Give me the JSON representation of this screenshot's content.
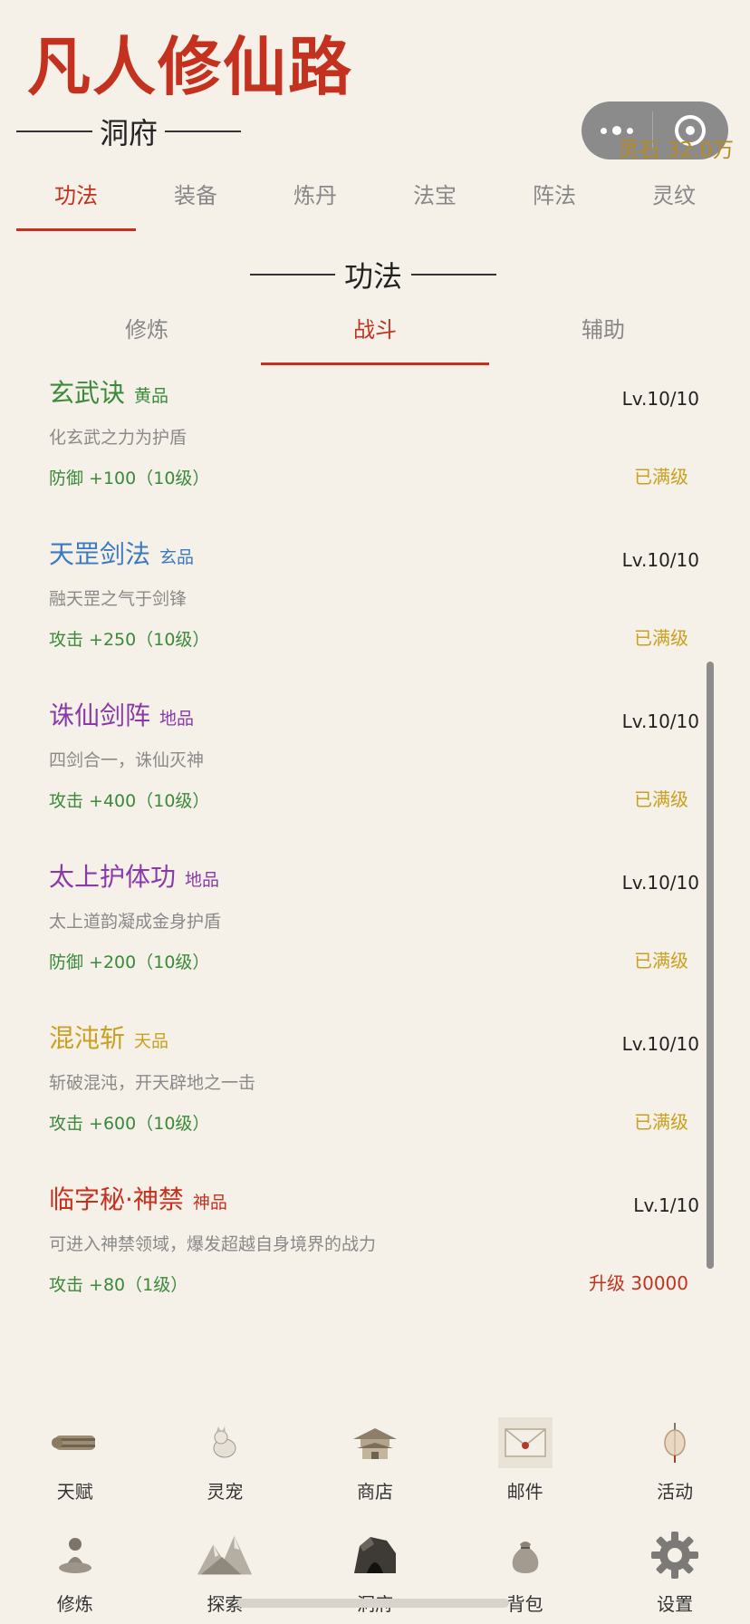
{
  "app": {
    "title": "凡人修仙路"
  },
  "header": {
    "spirit_stone": "灵石 32.0万",
    "section": "洞府"
  },
  "main_tabs": [
    {
      "label": "功法",
      "active": true
    },
    {
      "label": "装备",
      "active": false
    },
    {
      "label": "炼丹",
      "active": false
    },
    {
      "label": "法宝",
      "active": false
    },
    {
      "label": "阵法",
      "active": false
    },
    {
      "label": "灵纹",
      "active": false
    }
  ],
  "sub_section": "功法",
  "sub_tabs": [
    {
      "label": "修炼",
      "active": false
    },
    {
      "label": "战斗",
      "active": true
    },
    {
      "label": "辅助",
      "active": false
    }
  ],
  "skills": [
    {
      "name": "玄武诀",
      "grade": "黄品",
      "color": "#3a8a3a",
      "level": "Lv.10/10",
      "desc": "化玄武之力为护盾",
      "effect": "防御 +100（10级）",
      "status": "已满级"
    },
    {
      "name": "天罡剑法",
      "grade": "玄品",
      "color": "#3a7ac0",
      "level": "Lv.10/10",
      "desc": "融天罡之气于剑锋",
      "effect": "攻击 +250（10级）",
      "status": "已满级"
    },
    {
      "name": "诛仙剑阵",
      "grade": "地品",
      "color": "#8a3aa8",
      "level": "Lv.10/10",
      "desc": "四剑合一，诛仙灭神",
      "effect": "攻击 +400（10级）",
      "status": "已满级"
    },
    {
      "name": "太上护体功",
      "grade": "地品",
      "color": "#8a3aa8",
      "level": "Lv.10/10",
      "desc": "太上道韵凝成金身护盾",
      "effect": "防御 +200（10级）",
      "status": "已满级"
    },
    {
      "name": "混沌斩",
      "grade": "天品",
      "color": "#c9a020",
      "level": "Lv.10/10",
      "desc": "斩破混沌，开天辟地之一击",
      "effect": "攻击 +600（10级）",
      "status": "已满级"
    },
    {
      "name": "临字秘·神禁",
      "grade": "神品",
      "color": "#c4321f",
      "level": "Lv.1/10",
      "desc": "可进入神禁领域，爆发超越自身境界的战力",
      "effect": "攻击 +80（1级）",
      "status": "升级 30000"
    }
  ],
  "nav_row1": [
    {
      "label": "天赋",
      "icon": "scroll-icon"
    },
    {
      "label": "灵宠",
      "icon": "pet-icon"
    },
    {
      "label": "商店",
      "icon": "pavilion-icon"
    },
    {
      "label": "邮件",
      "icon": "mail-icon"
    },
    {
      "label": "活动",
      "icon": "lantern-icon"
    }
  ],
  "nav_row2": [
    {
      "label": "修炼",
      "icon": "meditation-icon"
    },
    {
      "label": "探索",
      "icon": "mountain-icon"
    },
    {
      "label": "洞府",
      "icon": "cave-icon"
    },
    {
      "label": "背包",
      "icon": "bag-icon"
    },
    {
      "label": "设置",
      "icon": "gear-icon"
    }
  ]
}
